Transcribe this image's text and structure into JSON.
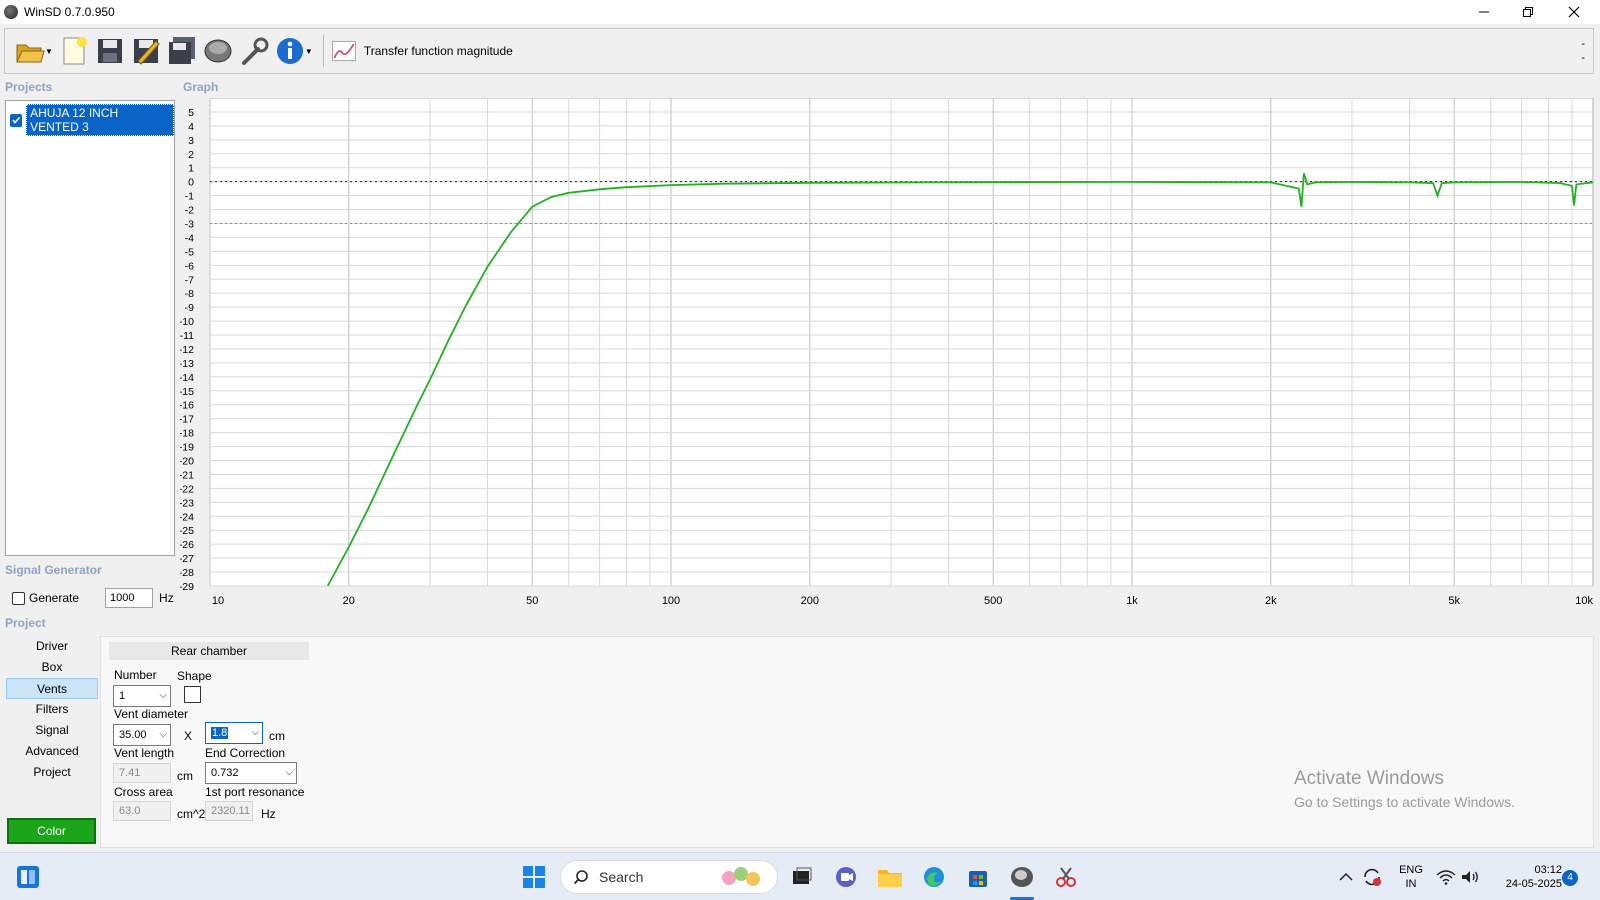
{
  "window": {
    "title": "WinSD 0.7.0.950"
  },
  "toolbar": {
    "graph_type_label": "Transfer function magnitude",
    "right_marks": [
      "-",
      "-"
    ]
  },
  "panels": {
    "projects_label": "Projects",
    "graph_label": "Graph",
    "signal_label": "Signal Generator",
    "project_label": "Project"
  },
  "projects": [
    {
      "name": "AHUJA 12 INCH VENTED 3",
      "checked": true
    }
  ],
  "signal_generator": {
    "generate_label": "Generate",
    "frequency": "1000",
    "unit": "Hz"
  },
  "nav": {
    "items": [
      "Driver",
      "Box",
      "Vents",
      "Filters",
      "Signal",
      "Advanced",
      "Project"
    ],
    "active": "Vents",
    "color_button": "Color"
  },
  "vents": {
    "header": "Rear chamber",
    "number_label": "Number",
    "number_value": "1",
    "shape_label": "Shape",
    "vent_diameter_label": "Vent diameter",
    "diameter_value": "35.00",
    "x_label": "X",
    "diameter2_value": "1.8",
    "cm_unit": "cm",
    "vent_length_label": "Vent length",
    "vent_length_value": "7.41",
    "end_correction_label": "End Correction",
    "end_correction_value": "0.732",
    "cross_area_label": "Cross area",
    "cross_area_value": "63.0",
    "cross_area_unit": "cm^2",
    "resonance_label": "1st port resonance",
    "resonance_value": "2320.11",
    "hz_unit": "Hz"
  },
  "activation": {
    "line1": "Activate Windows",
    "line2": "Go to Settings to activate Windows."
  },
  "taskbar": {
    "search_placeholder": "Search",
    "lang_top": "ENG",
    "lang_bottom": "IN",
    "time": "03:12",
    "date": "24-05-2025",
    "notification_count": "4"
  },
  "chart_data": {
    "type": "line",
    "title": "",
    "xlabel": "",
    "ylabel": "",
    "x_scale": "log",
    "xlim": [
      10,
      10000
    ],
    "ylim": [
      -29,
      5
    ],
    "x_ticks": [
      10,
      20,
      50,
      100,
      200,
      500,
      1000,
      2000,
      5000,
      10000
    ],
    "x_tick_labels": [
      "10",
      "20",
      "50",
      "100",
      "200",
      "500",
      "1k",
      "2k",
      "5k",
      "10k"
    ],
    "y_ticks": [
      5,
      4,
      3,
      2,
      1,
      0,
      -1,
      -2,
      -3,
      -4,
      -5,
      -6,
      -7,
      -8,
      -9,
      -10,
      -11,
      -12,
      -13,
      -14,
      -15,
      -16,
      -17,
      -18,
      -19,
      -20,
      -21,
      -22,
      -23,
      -24,
      -25,
      -26,
      -27,
      -28,
      -29
    ],
    "grid": true,
    "reference_lines": [
      0,
      -3
    ],
    "series": [
      {
        "color": "#22b022",
        "x": [
          18,
          20,
          22,
          25,
          28,
          30,
          33,
          36,
          40,
          45,
          50,
          55,
          60,
          70,
          80,
          100,
          130,
          200,
          500,
          1000,
          2000,
          2300,
          2330,
          2360,
          2400,
          2500,
          3000,
          4000,
          4500,
          4600,
          4700,
          5000,
          7000,
          8500,
          9000,
          9100,
          9200,
          10000
        ],
        "y": [
          -29,
          -26.2,
          -23.5,
          -19.6,
          -16.2,
          -14.2,
          -11.3,
          -8.8,
          -6.1,
          -3.6,
          -1.8,
          -1.1,
          -0.8,
          -0.55,
          -0.4,
          -0.25,
          -0.15,
          -0.08,
          -0.03,
          -0.02,
          -0.05,
          -0.5,
          -1.8,
          0.6,
          -0.2,
          -0.05,
          -0.02,
          -0.05,
          -0.1,
          -1.0,
          -0.1,
          -0.05,
          -0.02,
          -0.1,
          -0.3,
          -1.7,
          -0.2,
          -0.05
        ]
      }
    ]
  }
}
